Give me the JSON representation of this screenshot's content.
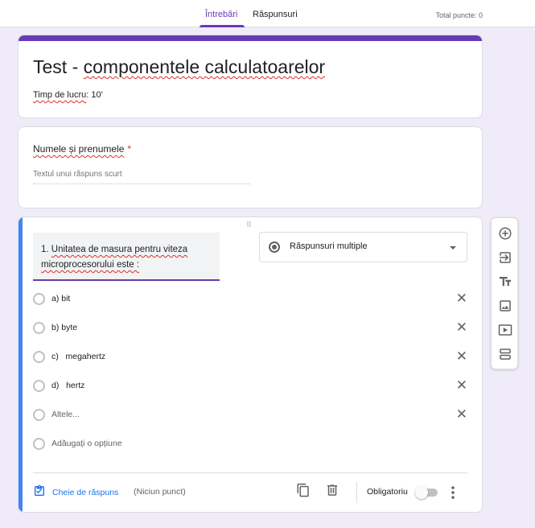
{
  "header": {
    "tabs": [
      {
        "label": "Întrebări",
        "active": true
      },
      {
        "label": "Răspunsuri",
        "active": false
      }
    ],
    "total_points": "Total puncte: 0"
  },
  "form": {
    "title": "Test - componentele calculatoarelor",
    "description_prefix": "Timp de lucru",
    "description_suffix": ": 10'"
  },
  "name_question": {
    "label": "Numele și prenumele",
    "required_mark": "*",
    "placeholder": "Textul unui răspuns scurt"
  },
  "question": {
    "drag_handle": "⠿",
    "text_line1": "1. Unitatea de masura pentru viteza",
    "text_line2": "microprocesorului este :",
    "type": "Răspunsuri multiple",
    "options": [
      {
        "label": "a) bit"
      },
      {
        "label": "b) byte"
      },
      {
        "label": "c)   megahertz"
      },
      {
        "label": "d)   hertz"
      },
      {
        "label": "Altele..."
      }
    ],
    "add_option": "Adăugați o opțiune",
    "answer_key": "Cheie de răspuns",
    "points": "(Niciun punct)",
    "required_label": "Obligatoriu",
    "required_on": false
  },
  "colors": {
    "accent": "#673ab7",
    "active_card": "#4285f4",
    "link": "#1a73e8",
    "background": "#f0ebf8"
  },
  "toolbar_icons": [
    "add-circle-icon",
    "import-question-icon",
    "title-text-icon",
    "image-icon",
    "video-icon",
    "section-icon"
  ]
}
